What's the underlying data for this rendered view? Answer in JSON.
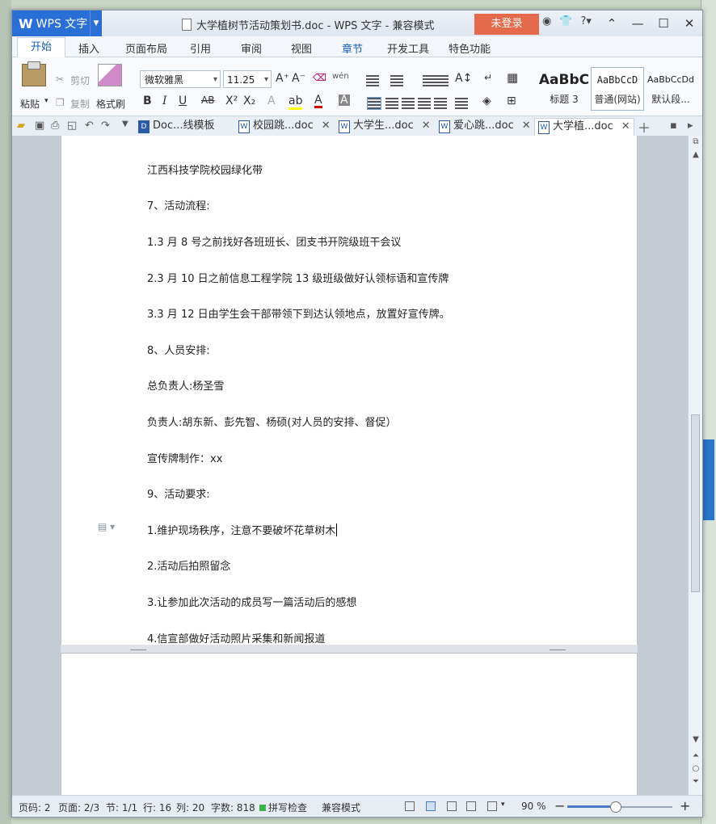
{
  "app": {
    "name": "WPS 文字",
    "window_title": "大学植树节活动策划书.doc - WPS 文字 - 兼容模式",
    "login_label": "未登录"
  },
  "menu_tabs": [
    "开始",
    "插入",
    "页面布局",
    "引用",
    "审阅",
    "视图",
    "章节",
    "开发工具",
    "特色功能"
  ],
  "ribbon": {
    "paste": "粘贴",
    "cut": "剪切",
    "copy": "复制",
    "format_painter": "格式刷",
    "font_name": "微软雅黑",
    "font_size": "11.25",
    "bold": "B",
    "italic": "I",
    "underline": "U",
    "strike": "AB",
    "superscript": "X²",
    "subscript": "X₂",
    "font_color_letter": "A",
    "styles": [
      {
        "sample": "AaBbC",
        "label": "标题 3"
      },
      {
        "sample": "AaBbCcD",
        "label": "普通(网站)"
      },
      {
        "sample": "AaBbCcDd",
        "label": "默认段..."
      }
    ]
  },
  "doc_tabs": [
    {
      "label": "Doc...线模板"
    },
    {
      "label": "校园跳...doc"
    },
    {
      "label": "大学生...doc"
    },
    {
      "label": "爱心跳...doc"
    },
    {
      "label": "大学植...doc"
    }
  ],
  "document": {
    "lines": [
      "江西科技学院校园绿化带",
      "7、活动流程:",
      "1.3 月 8 号之前找好各班班长、团支书开院级班干会议",
      "2.3 月 10 日之前信息工程学院 13 级班级做好认领标语和宣传牌",
      "3.3 月 12 日由学生会干部带领下到达认领地点，放置好宣传牌。",
      "8、人员安排:",
      "总负责人:杨圣雪",
      "负责人:胡东新、彭先智、杨硕(对人员的安排、督促）",
      "宣传牌制作：xx",
      "9、活动要求:",
      "1.维护现场秩序，注意不要破坏花草树木",
      "2.活动后拍照留念",
      "3.让参加此次活动的成员写一篇活动后的感想",
      "4.信宣部做好活动照片采集和新闻报道"
    ]
  },
  "status": {
    "page_num": "页码: 2",
    "pages": "页面: 2/3",
    "section": "节: 1/1",
    "row": "行: 16",
    "col": "列: 20",
    "word_count": "字数: 818",
    "spell_check": "拼写检查",
    "mode": "兼容模式",
    "zoom": "90 %",
    "zoom_fraction": 0.45
  }
}
